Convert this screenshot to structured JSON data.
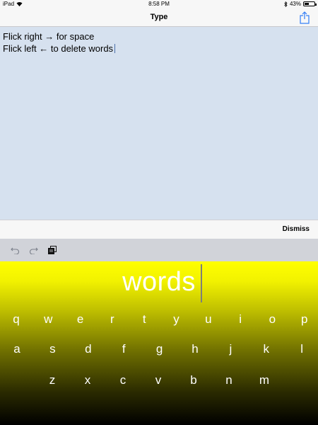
{
  "status_bar": {
    "device": "iPad",
    "time": "8:58 PM",
    "battery_percent": "43%",
    "battery_level": 0.43
  },
  "nav": {
    "title": "Type"
  },
  "editor": {
    "lines": [
      "Flick right → for space",
      "Flick left ← to delete words"
    ]
  },
  "dismiss_bar": {
    "dismiss_label": "Dismiss"
  },
  "toolbar": {
    "icons": [
      "undo-icon",
      "redo-icon",
      "clipboard-icon"
    ]
  },
  "keyboard": {
    "current_word": "words",
    "row1": [
      "q",
      "w",
      "e",
      "r",
      "t",
      "y",
      "u",
      "i",
      "o",
      "p"
    ],
    "row2": [
      "a",
      "s",
      "d",
      "f",
      "g",
      "h",
      "j",
      "k",
      "l"
    ],
    "row3": [
      "z",
      "x",
      "c",
      "v",
      "b",
      "n",
      "m"
    ],
    "colors": {
      "top": "#ffff00",
      "bottom": "#000000",
      "key_text": "#ffffff"
    }
  }
}
